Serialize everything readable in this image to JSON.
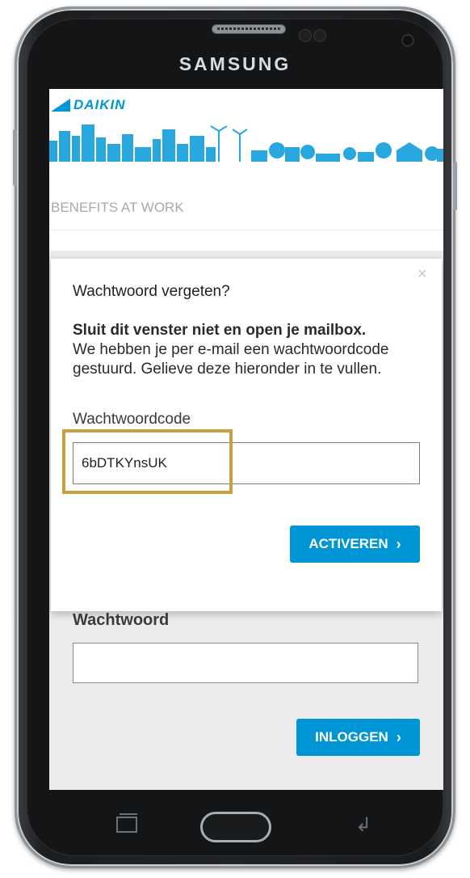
{
  "device": {
    "brand": "SAMSUNG"
  },
  "header": {
    "logo_text": "DAIKIN",
    "tagline": "BENEFITS AT WORK"
  },
  "login_form": {
    "password_label": "Wachtwoord",
    "password_value": "",
    "login_button": "INLOGGEN"
  },
  "modal": {
    "close_symbol": "×",
    "title": "Wachtwoord vergeten?",
    "instruction_bold": "Sluit dit venster niet en open je mailbox.",
    "instruction_text": "We hebben je per e-mail een wachtwoordcode gestuurd. Gelieve deze hieronder in te vullen.",
    "code_label": "Wachtwoordcode",
    "code_value": "6bDTKYnsUK",
    "activate_button": "ACTIVEREN"
  },
  "icons": {
    "chevron": "›",
    "nav_back": "back-arrow-icon",
    "nav_recent": "recent-apps-icon"
  },
  "colors": {
    "brand_blue": "#0097d7",
    "button_blue": "#0096d6",
    "highlight": "#c8a040"
  }
}
